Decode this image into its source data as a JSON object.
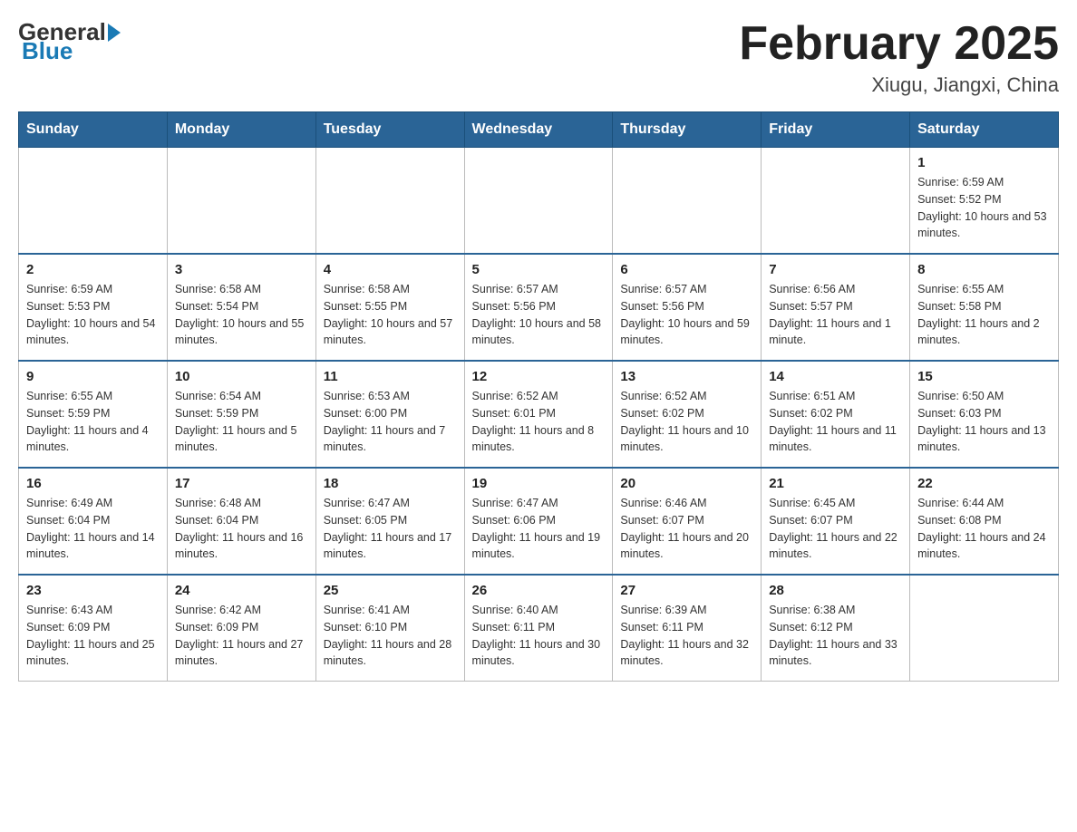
{
  "header": {
    "logo_general": "General",
    "logo_blue": "Blue",
    "month_title": "February 2025",
    "location": "Xiugu, Jiangxi, China"
  },
  "days_of_week": [
    "Sunday",
    "Monday",
    "Tuesday",
    "Wednesday",
    "Thursday",
    "Friday",
    "Saturday"
  ],
  "weeks": [
    [
      {
        "day": "",
        "info": ""
      },
      {
        "day": "",
        "info": ""
      },
      {
        "day": "",
        "info": ""
      },
      {
        "day": "",
        "info": ""
      },
      {
        "day": "",
        "info": ""
      },
      {
        "day": "",
        "info": ""
      },
      {
        "day": "1",
        "info": "Sunrise: 6:59 AM\nSunset: 5:52 PM\nDaylight: 10 hours and 53 minutes."
      }
    ],
    [
      {
        "day": "2",
        "info": "Sunrise: 6:59 AM\nSunset: 5:53 PM\nDaylight: 10 hours and 54 minutes."
      },
      {
        "day": "3",
        "info": "Sunrise: 6:58 AM\nSunset: 5:54 PM\nDaylight: 10 hours and 55 minutes."
      },
      {
        "day": "4",
        "info": "Sunrise: 6:58 AM\nSunset: 5:55 PM\nDaylight: 10 hours and 57 minutes."
      },
      {
        "day": "5",
        "info": "Sunrise: 6:57 AM\nSunset: 5:56 PM\nDaylight: 10 hours and 58 minutes."
      },
      {
        "day": "6",
        "info": "Sunrise: 6:57 AM\nSunset: 5:56 PM\nDaylight: 10 hours and 59 minutes."
      },
      {
        "day": "7",
        "info": "Sunrise: 6:56 AM\nSunset: 5:57 PM\nDaylight: 11 hours and 1 minute."
      },
      {
        "day": "8",
        "info": "Sunrise: 6:55 AM\nSunset: 5:58 PM\nDaylight: 11 hours and 2 minutes."
      }
    ],
    [
      {
        "day": "9",
        "info": "Sunrise: 6:55 AM\nSunset: 5:59 PM\nDaylight: 11 hours and 4 minutes."
      },
      {
        "day": "10",
        "info": "Sunrise: 6:54 AM\nSunset: 5:59 PM\nDaylight: 11 hours and 5 minutes."
      },
      {
        "day": "11",
        "info": "Sunrise: 6:53 AM\nSunset: 6:00 PM\nDaylight: 11 hours and 7 minutes."
      },
      {
        "day": "12",
        "info": "Sunrise: 6:52 AM\nSunset: 6:01 PM\nDaylight: 11 hours and 8 minutes."
      },
      {
        "day": "13",
        "info": "Sunrise: 6:52 AM\nSunset: 6:02 PM\nDaylight: 11 hours and 10 minutes."
      },
      {
        "day": "14",
        "info": "Sunrise: 6:51 AM\nSunset: 6:02 PM\nDaylight: 11 hours and 11 minutes."
      },
      {
        "day": "15",
        "info": "Sunrise: 6:50 AM\nSunset: 6:03 PM\nDaylight: 11 hours and 13 minutes."
      }
    ],
    [
      {
        "day": "16",
        "info": "Sunrise: 6:49 AM\nSunset: 6:04 PM\nDaylight: 11 hours and 14 minutes."
      },
      {
        "day": "17",
        "info": "Sunrise: 6:48 AM\nSunset: 6:04 PM\nDaylight: 11 hours and 16 minutes."
      },
      {
        "day": "18",
        "info": "Sunrise: 6:47 AM\nSunset: 6:05 PM\nDaylight: 11 hours and 17 minutes."
      },
      {
        "day": "19",
        "info": "Sunrise: 6:47 AM\nSunset: 6:06 PM\nDaylight: 11 hours and 19 minutes."
      },
      {
        "day": "20",
        "info": "Sunrise: 6:46 AM\nSunset: 6:07 PM\nDaylight: 11 hours and 20 minutes."
      },
      {
        "day": "21",
        "info": "Sunrise: 6:45 AM\nSunset: 6:07 PM\nDaylight: 11 hours and 22 minutes."
      },
      {
        "day": "22",
        "info": "Sunrise: 6:44 AM\nSunset: 6:08 PM\nDaylight: 11 hours and 24 minutes."
      }
    ],
    [
      {
        "day": "23",
        "info": "Sunrise: 6:43 AM\nSunset: 6:09 PM\nDaylight: 11 hours and 25 minutes."
      },
      {
        "day": "24",
        "info": "Sunrise: 6:42 AM\nSunset: 6:09 PM\nDaylight: 11 hours and 27 minutes."
      },
      {
        "day": "25",
        "info": "Sunrise: 6:41 AM\nSunset: 6:10 PM\nDaylight: 11 hours and 28 minutes."
      },
      {
        "day": "26",
        "info": "Sunrise: 6:40 AM\nSunset: 6:11 PM\nDaylight: 11 hours and 30 minutes."
      },
      {
        "day": "27",
        "info": "Sunrise: 6:39 AM\nSunset: 6:11 PM\nDaylight: 11 hours and 32 minutes."
      },
      {
        "day": "28",
        "info": "Sunrise: 6:38 AM\nSunset: 6:12 PM\nDaylight: 11 hours and 33 minutes."
      },
      {
        "day": "",
        "info": ""
      }
    ]
  ]
}
